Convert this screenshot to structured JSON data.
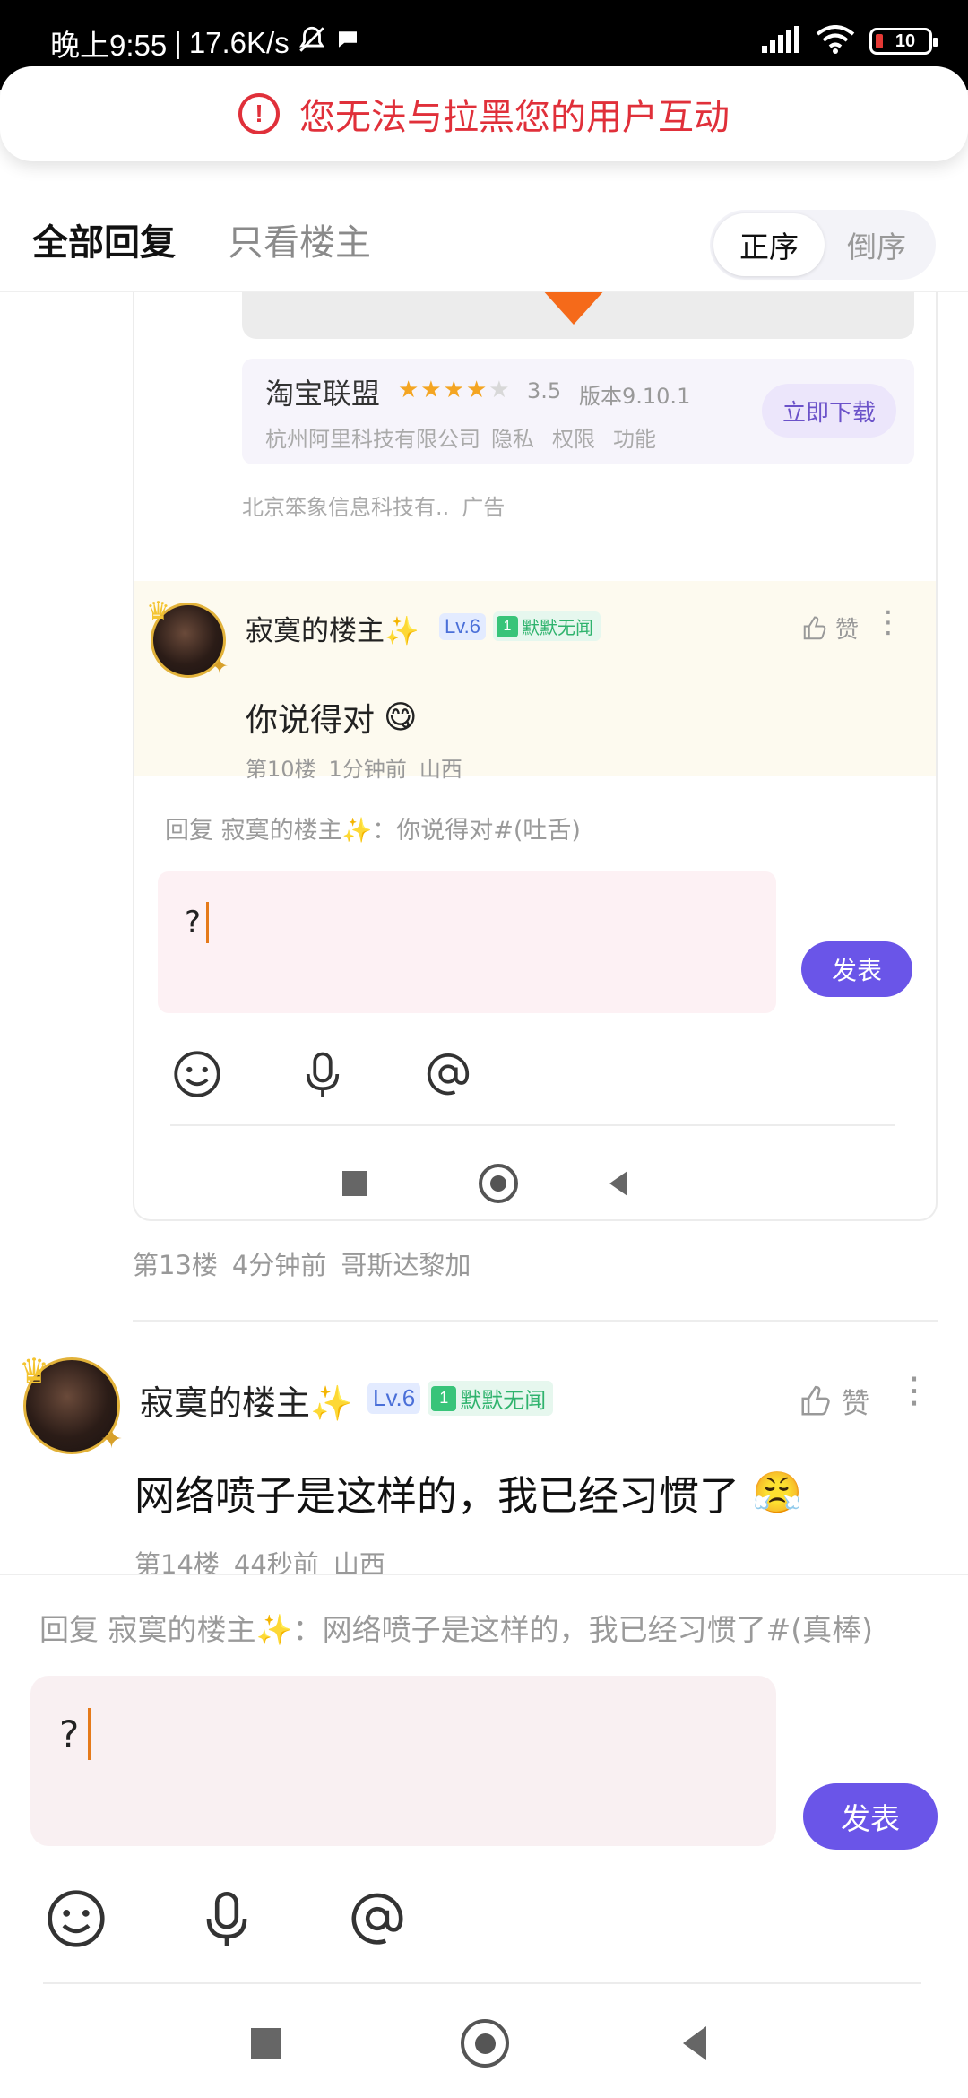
{
  "status_bar": {
    "time": "晚上9:55",
    "separator": "|",
    "speed": "17.6K/s",
    "battery": "10",
    "icons": [
      "bell-off-icon",
      "chat-bubble-icon",
      "signal-icon",
      "wifi-icon",
      "battery-icon"
    ]
  },
  "toast": {
    "icon": "!",
    "text": "您无法与拉黑您的用户互动",
    "color": "#e0303a"
  },
  "tabs": {
    "all_replies": "全部回复",
    "owner_only": "只看楼主",
    "sort_asc": "正序",
    "sort_desc": "倒序"
  },
  "embedded": {
    "ad": {
      "app_name": "淘宝联盟",
      "rating_stars": 3.5,
      "rating": "3.5",
      "version": "版本9.10.1",
      "company": "杭州阿里科技有限公司",
      "links": [
        "隐私",
        "权限",
        "功能"
      ],
      "download": "立即下载",
      "source": "北京笨象信息科技有..",
      "ad_label": "广告"
    },
    "comment": {
      "username": "寂寞的楼主✨",
      "level": "Lv.6",
      "medal_num": "1",
      "medal_name": "默默无闻",
      "like": "赞",
      "text": "你说得对",
      "emoji": "😋",
      "floor": "第10楼",
      "time": "1分钟前",
      "location": "山西"
    },
    "reply_line": "回复 寂寞的楼主✨：你说得对#(吐舌)",
    "input_value": "?",
    "send": "发表"
  },
  "floor13": {
    "floor": "第13楼",
    "time": "4分钟前",
    "location": "哥斯达黎加"
  },
  "comment14": {
    "username": "寂寞的楼主✨",
    "level": "Lv.6",
    "medal_num": "1",
    "medal_name": "默默无闻",
    "like": "赞",
    "text": "网络喷子是这样的，我已经习惯了",
    "emoji": "😤",
    "floor": "第14楼",
    "time": "44秒前",
    "location": "山西"
  },
  "reply_panel": {
    "reply_line": "回复 寂寞的楼主✨：网络喷子是这样的，我已经习惯了#(真棒)",
    "input_value": "?",
    "send": "发表"
  },
  "colors": {
    "accent": "#6a55e8",
    "caret": "#e57a1a",
    "medal": "#38c479",
    "level": "#4a6fd8"
  }
}
